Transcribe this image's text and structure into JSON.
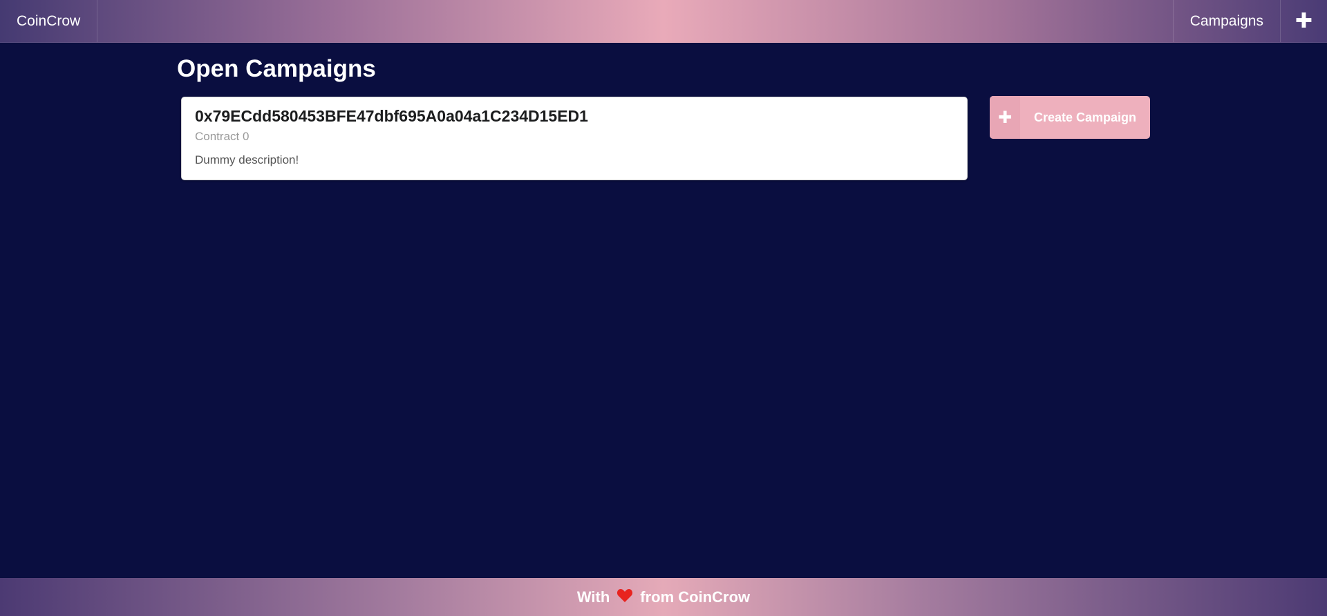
{
  "nav": {
    "brand": "CoinCrow",
    "campaigns_label": "Campaigns",
    "plus_icon": "plus-icon"
  },
  "main": {
    "title": "Open Campaigns",
    "campaigns": [
      {
        "address": "0x79ECdd580453BFE47dbf695A0a04a1C234D15ED1",
        "meta": "Contract 0",
        "description": "Dummy description!"
      }
    ],
    "create_button_label": "Create Campaign",
    "create_button_icon": "plus-icon"
  },
  "footer": {
    "prefix": "With",
    "icon": "heart-icon",
    "suffix": "from CoinCrow"
  },
  "colors": {
    "background": "#0a0e40",
    "accent": "#eeb0bd",
    "heart": "#e8231f"
  }
}
